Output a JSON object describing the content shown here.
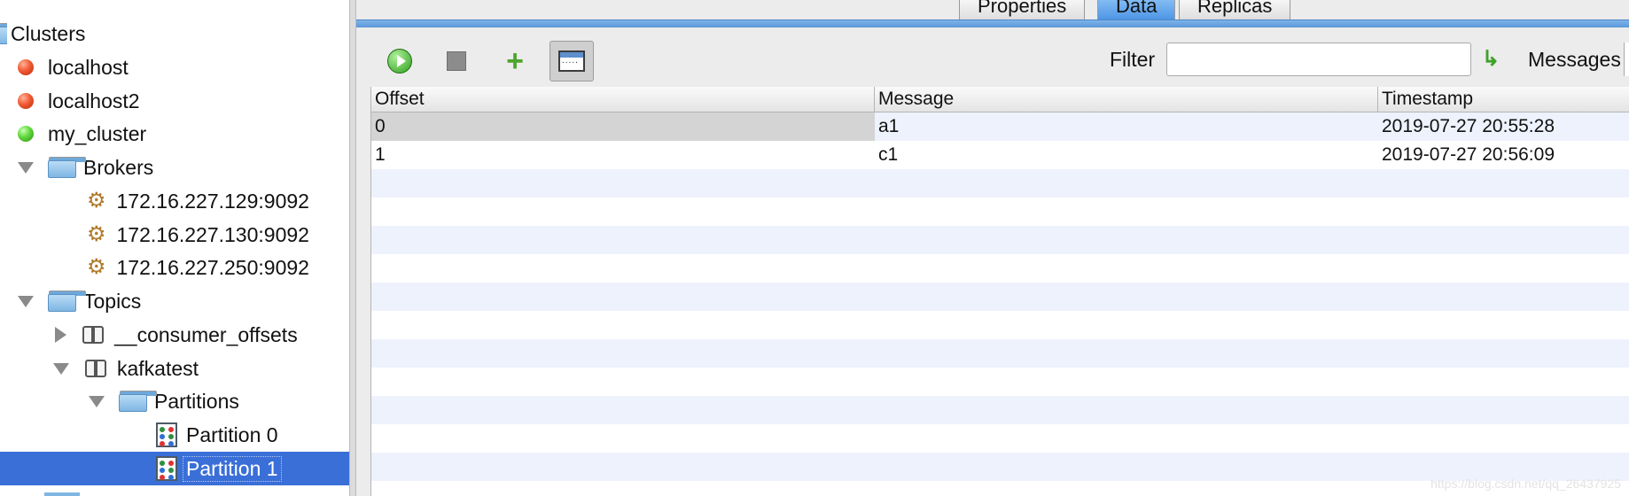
{
  "tree": {
    "root_label": "Clusters",
    "clusters": [
      {
        "label": "localhost",
        "status": "disconnected",
        "color": "#e8462a"
      },
      {
        "label": "localhost2",
        "status": "disconnected",
        "color": "#e8462a"
      },
      {
        "label": "my_cluster",
        "status": "connected",
        "color": "#4cc22f"
      }
    ],
    "brokers_label": "Brokers",
    "brokers": [
      "172.16.227.129:9092",
      "172.16.227.130:9092",
      "172.16.227.250:9092"
    ],
    "topics_label": "Topics",
    "topics": [
      "__consumer_offsets",
      "kafkatest"
    ],
    "partitions_label": "Partitions",
    "partitions": [
      "Partition 0",
      "Partition 1"
    ],
    "selected": "Partition 1"
  },
  "tabs": [
    "Properties",
    "Data",
    "Replicas"
  ],
  "active_tab": "Data",
  "toolbar": {
    "filter_label": "Filter",
    "filter_value": "",
    "messages_label": "Messages"
  },
  "table": {
    "columns": [
      "Offset",
      "Message",
      "Timestamp"
    ],
    "rows": [
      {
        "offset": "0",
        "message": "a1",
        "timestamp": "2019-07-27 20:55:28"
      },
      {
        "offset": "1",
        "message": "c1",
        "timestamp": "2019-07-27 20:56:09"
      }
    ]
  },
  "watermark": "https://blog.csdn.net/qq_26437925"
}
